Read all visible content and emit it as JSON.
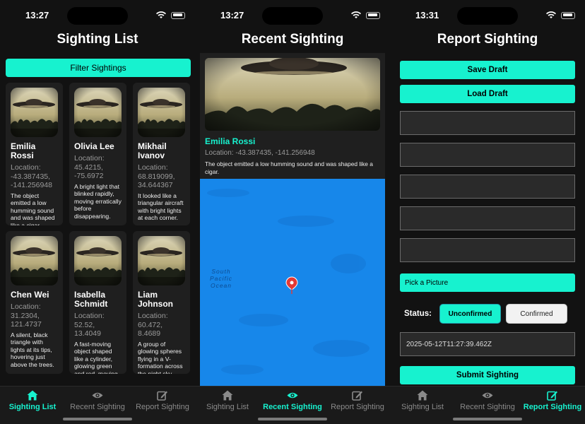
{
  "screens": [
    {
      "time": "13:27",
      "title": "Sighting List"
    },
    {
      "time": "13:27",
      "title": "Recent Sighting"
    },
    {
      "time": "13:31",
      "title": "Report Sighting"
    }
  ],
  "accent": "#17f2cf",
  "list": {
    "filter_label": "Filter Sightings",
    "location_prefix": "Location:",
    "items": [
      {
        "name": "Emilia Rossi",
        "location": "Location: -43.387435, -141.256948",
        "description": "The object emitted a low humming sound and was shaped like a cigar."
      },
      {
        "name": "Olivia Lee",
        "location": "Location: 45.4215, -75.6972",
        "description": "A bright light that blinked rapidly, moving erratically before disappearing."
      },
      {
        "name": "Mikhail Ivanov",
        "location": "Location: 68.819099, 34.644367",
        "description": "It looked like a triangular aircraft with bright lights at each corner."
      },
      {
        "name": "Chen Wei",
        "location": "Location: 31.2304, 121.4737",
        "description": "A silent, black triangle with lights at its tips, hovering just above the trees."
      },
      {
        "name": "Isabella Schmidt",
        "location": "Location: 52.52, 13.4049",
        "description": "A fast-moving object shaped like a cylinder, glowing green and red, moving horizontally across the sky."
      },
      {
        "name": "Liam Johnson",
        "location": "Location: 60.472, 8.4689",
        "description": "A group of glowing spheres flying in a V-formation across the night sky."
      }
    ]
  },
  "recent": {
    "name": "Emilia Rossi",
    "location": "Location: -43.387435, -141.256948",
    "description": "The object emitted a low humming sound and was shaped like a cigar.",
    "map_label": "South Pacific Ocean"
  },
  "report": {
    "save_draft": "Save Draft",
    "load_draft": "Load Draft",
    "pick_picture": "Pick a Picture",
    "status_label": "Status:",
    "status_options": [
      "Unconfirmed",
      "Confirmed"
    ],
    "selected_status": "Unconfirmed",
    "datetime": "2025-05-12T11:27:39.462Z",
    "submit": "Submit Sighting"
  },
  "tabs": [
    {
      "label": "Sighting List",
      "icon": "home-icon"
    },
    {
      "label": "Recent Sighting",
      "icon": "eye-icon"
    },
    {
      "label": "Report Sighting",
      "icon": "edit-icon"
    }
  ]
}
